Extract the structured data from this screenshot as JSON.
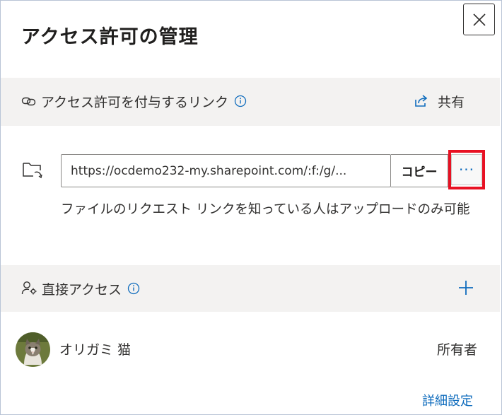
{
  "dialog": {
    "title": "アクセス許可の管理"
  },
  "links_section": {
    "label": "アクセス許可を付与するリンク",
    "share_label": "共有"
  },
  "link": {
    "url": "https://ocdemo232-my.sharepoint.com/:f:/g/...",
    "copy_label": "コピー",
    "more_label": "···",
    "description": "ファイルのリクエスト リンクを知っている人はアップロードのみ可能"
  },
  "direct_section": {
    "label": "直接アクセス"
  },
  "user": {
    "name": "オリガミ 猫",
    "role": "所有者"
  },
  "footer": {
    "advanced_label": "詳細設定"
  },
  "colors": {
    "accent": "#0f6cbd",
    "highlight": "#e81123",
    "band": "#f3f2f1"
  }
}
